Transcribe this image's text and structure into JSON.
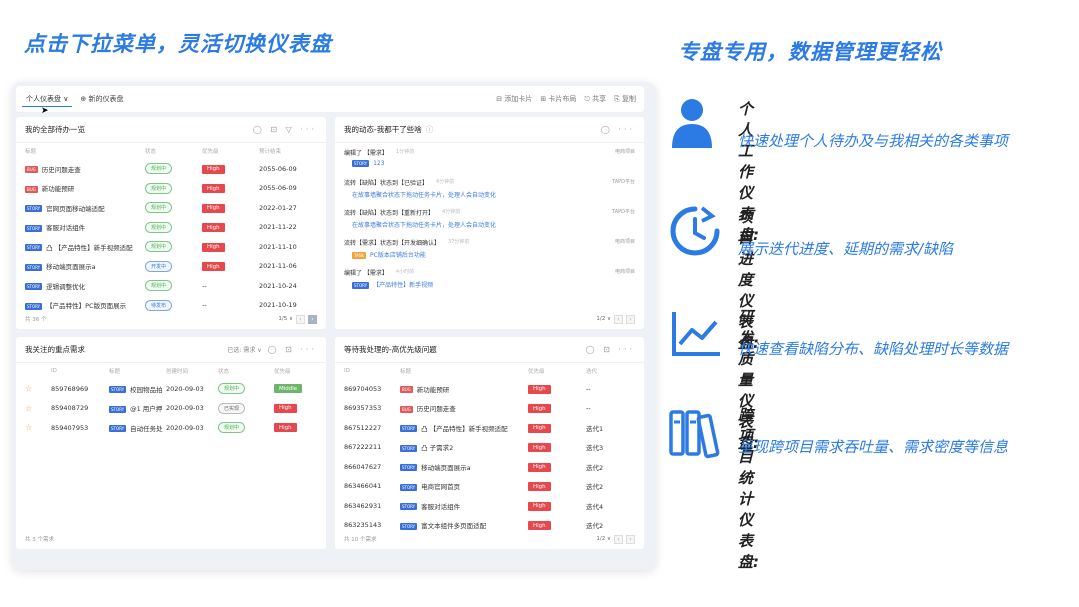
{
  "headings": {
    "left": "点击下拉菜单，灵活切换仪表盘",
    "right": "专盘专用，数据管理更轻松"
  },
  "toolbar": {
    "select": "个人仪表盘 ∨",
    "add": "⊕ 新的仪表盘",
    "actions": [
      "⊟ 添加卡片",
      "⊞ 卡片布局",
      "⎋ 共享",
      "⎘ 复制"
    ]
  },
  "todo": {
    "title": "我的全部待办一览",
    "icons": "◯ ⊡ ▽ ···",
    "headers": [
      "标题",
      "状态",
      "优先级",
      "预计结束"
    ],
    "rows": [
      {
        "tag": "BUG",
        "type": "bug",
        "title": "历史问题走查",
        "status": "规划中",
        "stype": "green",
        "priority": "High",
        "date": "2055-06-09"
      },
      {
        "tag": "BUG",
        "type": "bug",
        "title": "新功能预研",
        "status": "规划中",
        "stype": "green",
        "priority": "High",
        "date": "2055-06-09"
      },
      {
        "tag": "STORY",
        "type": "story",
        "title": "官网页面移动端适配",
        "status": "规划中",
        "stype": "green",
        "priority": "High",
        "date": "2022-01-27"
      },
      {
        "tag": "STORY",
        "type": "story",
        "title": "客服对话组件",
        "status": "规划中",
        "stype": "green",
        "priority": "High",
        "date": "2021-11-22"
      },
      {
        "tag": "STORY",
        "type": "story",
        "title": "凸 【产品特性】新手视频适配",
        "status": "规划中",
        "stype": "green",
        "priority": "High",
        "date": "2021-11-10"
      },
      {
        "tag": "STORY",
        "type": "story",
        "title": "移动端页面展示a",
        "status": "开发中",
        "stype": "blue",
        "priority": "High",
        "date": "2021-11-06"
      },
      {
        "tag": "STORY",
        "type": "story",
        "title": "逻辑调整优化",
        "status": "规划中",
        "stype": "green",
        "priority": "--",
        "date": "2021-10-24"
      },
      {
        "tag": "STORY",
        "type": "story",
        "title": "【产品特性】PC版页面展示",
        "status": "待发布",
        "stype": "blue",
        "priority": "--",
        "date": "2021-10-19"
      }
    ],
    "footer": "共 36 个",
    "page": "1/5 ∨"
  },
  "activity": {
    "title": "我的动态-我都干了些啥",
    "help": "ⓘ",
    "icons": "◯ ···",
    "items": [
      {
        "l1": "编辑了 【需求】",
        "time": "1分钟前",
        "src": "电商项目",
        "tag": "STORY",
        "type": "story",
        "l2": "123"
      },
      {
        "l1": "流转【缺陷】状态到【已验证】",
        "time": "4分钟前",
        "src": "TAPD平台",
        "tag": "",
        "type": "",
        "l2": "在故事墙聚合状态下拖动任务卡片，处理人会自动变化"
      },
      {
        "l1": "流转【缺陷】状态到【重新打开】",
        "time": "4分钟前",
        "src": "TAPD平台",
        "tag": "",
        "type": "",
        "l2": "在故事墙聚合状态下拖动任务卡片，处理人会自动变化"
      },
      {
        "l1": "流转【需求】状态到【开发细确认】",
        "time": "37分钟前",
        "src": "电商项目",
        "tag": "TASK",
        "type": "task",
        "l2": "PC版本店铺后台功能"
      },
      {
        "l1": "编辑了 【需求】",
        "time": "4小时前",
        "src": "电商项目",
        "tag": "STORY",
        "type": "story",
        "l2": "【产品特性】新手视频"
      }
    ],
    "page": "1/2 ∨"
  },
  "focus": {
    "title": "我关注的重点需求",
    "filter": "已选: 需求 ∨",
    "icons": "◯ ⊡ ···",
    "headers": [
      "",
      "ID",
      "标题",
      "创建时间",
      "状态",
      "优先级"
    ],
    "rows": [
      {
        "id": "859768969",
        "tag": "STORY",
        "title": "校园物品拍",
        "date": "2020-09-03",
        "status": "规划中",
        "stype": "green",
        "priority": "Middle",
        "ptype": "mid"
      },
      {
        "id": "859408729",
        "tag": "STORY",
        "title": "@1 用户押",
        "date": "2020-09-03",
        "status": "已实现",
        "stype": "gray",
        "priority": "High",
        "ptype": ""
      },
      {
        "id": "859407953",
        "tag": "STORY",
        "title": "自动任务处",
        "date": "2020-09-03",
        "status": "规划中",
        "stype": "green",
        "priority": "High",
        "ptype": ""
      }
    ],
    "footer": "共 3 个需求"
  },
  "pending": {
    "title": "等待我处理的-高优先级问题",
    "icons": "◯ ⊡ ···",
    "headers": [
      "ID",
      "标题",
      "优先级",
      "迭代"
    ],
    "rows": [
      {
        "id": "869704053",
        "tag": "BUG",
        "type": "bug",
        "title": "新功能预研",
        "priority": "High",
        "iter": "--"
      },
      {
        "id": "869357353",
        "tag": "BUG",
        "type": "bug",
        "title": "历史问题走查",
        "priority": "High",
        "iter": "--"
      },
      {
        "id": "867512227",
        "tag": "STORY",
        "type": "story",
        "title": "凸 【产品特性】新手视频适配",
        "priority": "High",
        "iter": "迭代1"
      },
      {
        "id": "867222211",
        "tag": "STORY",
        "type": "story",
        "title": "凸 子需求2",
        "priority": "High",
        "iter": "迭代3"
      },
      {
        "id": "866047627",
        "tag": "STORY",
        "type": "story",
        "title": "移动端页面展示a",
        "priority": "High",
        "iter": "迭代2"
      },
      {
        "id": "863466041",
        "tag": "STORY",
        "type": "story",
        "title": "电商官网首页",
        "priority": "High",
        "iter": "迭代2"
      },
      {
        "id": "863462931",
        "tag": "STORY",
        "type": "story",
        "title": "客服对话组件",
        "priority": "High",
        "iter": "迭代4"
      },
      {
        "id": "863235143",
        "tag": "STORY",
        "type": "story",
        "title": "富文本组件多页面适配",
        "priority": "High",
        "iter": "迭代2"
      }
    ],
    "footer": "共 10 个需求",
    "page": "1/2 ∨"
  },
  "features": [
    {
      "icon": "person-icon",
      "title": "个人工作仪表盘:",
      "desc": "快速处理个人待办及与我相关的各类事项"
    },
    {
      "icon": "clock-icon",
      "title": "项目进度仪表盘:",
      "desc": "展示迭代进度、延期的需求/缺陷"
    },
    {
      "icon": "line-chart-icon",
      "title": "研发质量仪表盘:",
      "desc": "快速查看缺陷分布、缺陷处理时长等数据"
    },
    {
      "icon": "binders-icon",
      "title": "跨项目统计仪表盘:",
      "desc": "呈现跨项目需求吞吐量、需求密度等信息"
    }
  ],
  "colors": {
    "accent": "#2c7be5",
    "high": "#e5484d",
    "middle": "#6cb56b"
  }
}
